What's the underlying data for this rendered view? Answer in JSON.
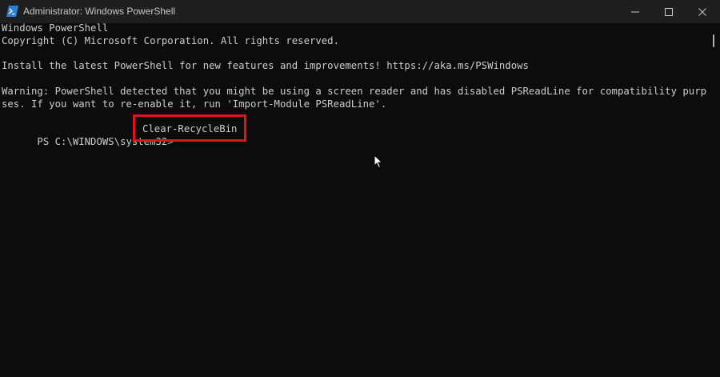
{
  "window": {
    "title": "Administrator: Windows PowerShell",
    "controls": {
      "minimize_icon": "minimize-icon",
      "maximize_icon": "maximize-icon",
      "close_icon": "close-icon"
    }
  },
  "console": {
    "lines": [
      "Windows PowerShell",
      "Copyright (C) Microsoft Corporation. All rights reserved.",
      "",
      "Install the latest PowerShell for new features and improvements! https://aka.ms/PSWindows",
      "",
      "Warning: PowerShell detected that you might be using a screen reader and has disabled PSReadLine for compatibility purpo",
      "ses. If you want to re-enable it, run 'Import-Module PSReadLine'.",
      ""
    ],
    "prompt": "PS C:\\WINDOWS\\system32>",
    "command": "Clear-RecycleBin"
  },
  "colors": {
    "background": "#0c0c0c",
    "titlebar": "#1f1f1f",
    "text": "#cccccc",
    "highlight": "#e0141e",
    "app_icon": "#2a7fd4"
  }
}
